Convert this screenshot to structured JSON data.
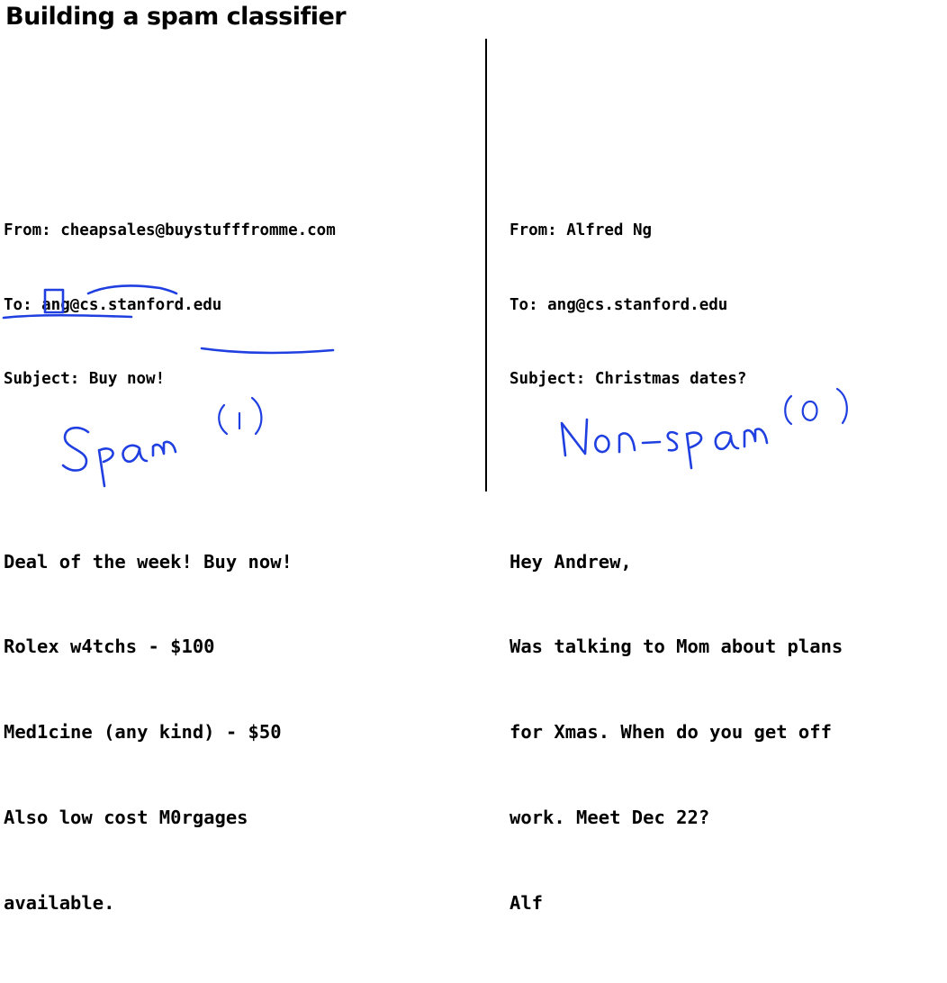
{
  "title": "Building a spam classifier",
  "spam_email": {
    "from": "From: cheapsales@buystufffromme.com",
    "to": "To: ang@cs.stanford.edu",
    "subject": "Subject: Buy now!",
    "body": [
      "Deal of the week! Buy now!",
      "Rolex w4tchs - $100",
      "Med1cine (any kind) - $50",
      "Also low cost M0rgages",
      "available."
    ]
  },
  "ham_email": {
    "from": "From: Alfred Ng",
    "to": "To: ang@cs.stanford.edu",
    "subject": "Subject: Christmas dates?",
    "body": [
      "Hey Andrew,",
      "Was talking to Mom about plans",
      "for Xmas. When do you get off",
      "work. Meet Dec 22?",
      "Alf"
    ]
  },
  "handwritten": {
    "spam_label": "Spam (1)",
    "nonspam_label": "Non-spam (0)"
  },
  "ink_color": "#1f3fe0"
}
